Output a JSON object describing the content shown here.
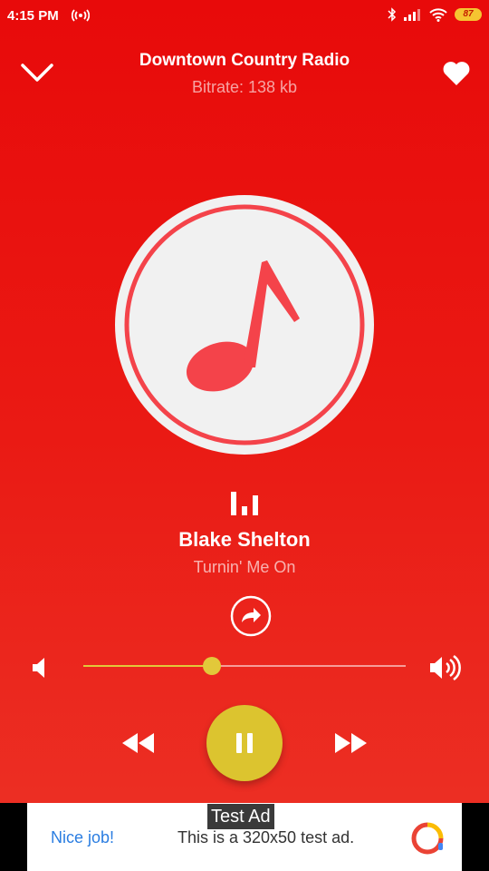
{
  "status_bar": {
    "time": "4:15 PM",
    "battery": "87"
  },
  "header": {
    "station": "Downtown Country Radio",
    "bitrate": "Bitrate: 138 kb"
  },
  "track": {
    "artist": "Blake Shelton",
    "title": "Turnin' Me On"
  },
  "volume": {
    "level": 0.4
  },
  "ad": {
    "tag": "Test Ad",
    "nice": "Nice job!",
    "text": "This is a 320x50 test ad."
  },
  "colors": {
    "accent": "#e80a0a",
    "play_button": "#dcc42f",
    "slider": "#e2c83a",
    "note": "#f4434a"
  },
  "icons": [
    "chevron-down-icon",
    "heart-icon",
    "music-note-icon",
    "equalizer-icon",
    "share-icon",
    "volume-low-icon",
    "volume-high-icon",
    "rewind-icon",
    "pause-icon",
    "fast-forward-icon"
  ]
}
